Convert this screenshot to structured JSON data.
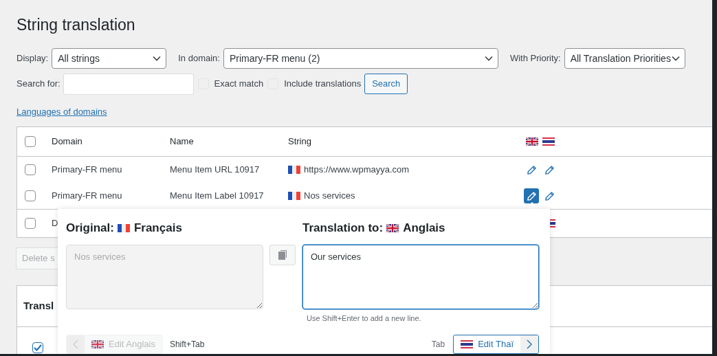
{
  "page_title": "String translation",
  "filters": [
    {
      "label": "Display:",
      "value": "All strings"
    },
    {
      "label": "In domain:",
      "value": "Primary-FR menu (2)"
    },
    {
      "label": "With Priority:",
      "value": "All Translation Priorities"
    }
  ],
  "search": {
    "label": "Search for:",
    "options": [
      {
        "label": "Exact match",
        "checked": false
      },
      {
        "label": "Include translations",
        "checked": false
      }
    ],
    "button": "Search"
  },
  "languages_link": "Languages of domains",
  "table": {
    "header_checked": false,
    "columns": [
      "Domain",
      "Name",
      "String"
    ],
    "language_flags": [
      {
        "kind": "uk"
      },
      {
        "kind": "th"
      }
    ],
    "rows": [
      {
        "checked": false,
        "domain": "Primary-FR menu",
        "name": "Menu Item URL 10917",
        "string": "https://www.wpmayya.com",
        "source_flag": {
          "kind": "fr"
        },
        "translations": [
          {
            "kind": "edit",
            "selected": false
          },
          {
            "kind": "edit",
            "selected": false
          }
        ]
      },
      {
        "checked": false,
        "domain": "Primary-FR menu",
        "name": "Menu Item Label 10917",
        "string": "Nos services",
        "source_flag": {
          "kind": "fr"
        },
        "translations": [
          {
            "kind": "edit",
            "selected": true
          },
          {
            "kind": "edit",
            "selected": false
          }
        ]
      },
      {
        "checked": false,
        "domain": "D",
        "translations": [
          {
            "kind": "empty"
          },
          {
            "kind": "flag",
            "flag": {
              "kind": "th"
            }
          }
        ]
      }
    ]
  },
  "bulk_button": "Delete s",
  "panel": {
    "title": "Transl",
    "items": [
      {
        "checked": true
      }
    ]
  },
  "editor": {
    "original": {
      "label": "Original:",
      "flag": {
        "kind": "fr"
      },
      "language": "Français",
      "text": "Nos services"
    },
    "translation": {
      "label": "Translation to:",
      "flag": {
        "kind": "uk"
      },
      "language": "Anglais",
      "value": "Our services",
      "hint": "Use Shift+Enter to add a new line."
    },
    "prev": {
      "label": "Edit Anglais",
      "flag": {
        "kind": "uk"
      },
      "shortcut": "Shift+Tab",
      "disabled": true
    },
    "next": {
      "label": "Edit Thaï",
      "flag": {
        "kind": "th"
      },
      "shortcut": "Tab",
      "disabled": false
    }
  }
}
